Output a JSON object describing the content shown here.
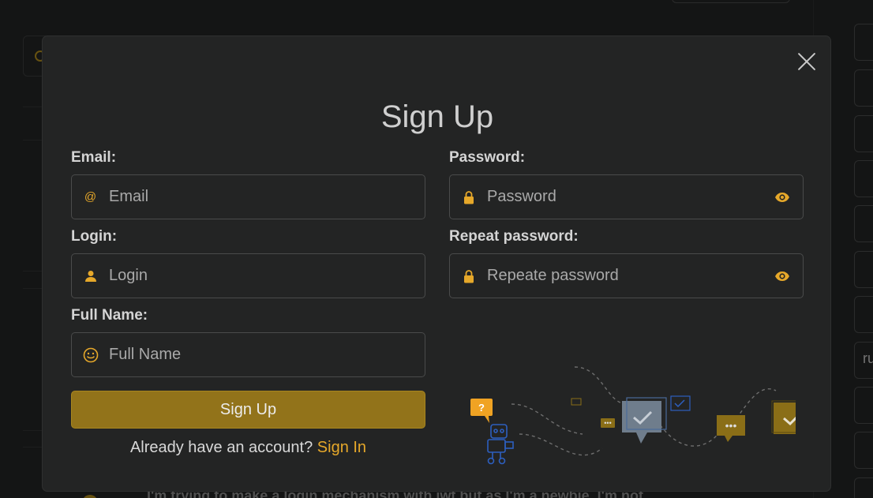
{
  "background": {
    "side_input_text": "ru",
    "post_text": "I'm trying to make a login mechanism with jwt but as I'm a newbie, I'm not"
  },
  "modal": {
    "title": "Sign Up",
    "close_label": "×"
  },
  "form": {
    "email": {
      "label": "Email:",
      "placeholder": "Email",
      "value": "",
      "icon": "at-icon"
    },
    "login": {
      "label": "Login:",
      "placeholder": "Login",
      "value": "",
      "icon": "user-icon"
    },
    "full_name": {
      "label": "Full Name:",
      "placeholder": "Full Name",
      "value": "",
      "icon": "smiley-icon"
    },
    "password": {
      "label": "Password:",
      "placeholder": "Password",
      "value": "",
      "icon": "lock-icon"
    },
    "repeat_password": {
      "label": "Repeat password:",
      "placeholder": "Repeate password",
      "value": "",
      "icon": "lock-icon"
    },
    "submit_label": "Sign Up",
    "signin_prompt": "Already have an account?",
    "signin_link": "Sign In"
  },
  "colors": {
    "accent": "#e6a82a",
    "button": "#92731a",
    "modal_bg": "#232424",
    "page_bg": "#1b1c1c"
  }
}
